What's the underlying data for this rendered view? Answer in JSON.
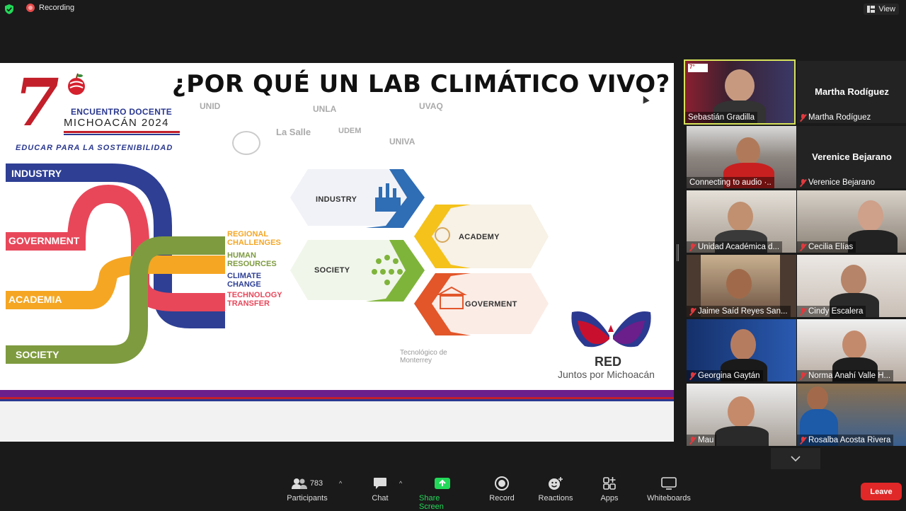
{
  "topbar": {
    "recording_label": "Recording",
    "view_label": "View"
  },
  "slide": {
    "title": "¿POR QUÉ UN LAB CLIMÁTICO VIVO?",
    "event_logo": {
      "number": "7",
      "line1": "ENCUENTRO DOCENTE",
      "line2": "MICHOACÁN 2024",
      "line3": "EDUCAR PARA LA SOSTENIBILIDAD"
    },
    "institutions": [
      "UNID",
      "UNLA",
      "UVAQ",
      "La Salle",
      "UDEM",
      "UNIVA",
      "Tecnológico de Monterrey"
    ],
    "stream_labels": [
      "INDUSTRY",
      "GOVERNMENT",
      "ACADEMIA",
      "SOCIETY"
    ],
    "stream_colors": {
      "industry": "#2e3f94",
      "government": "#e8475a",
      "academia": "#f5a623",
      "society": "#7e9b3f"
    },
    "outcomes": [
      {
        "label": "REGIONAL CHALLENGES",
        "line1": "REGIONAL",
        "line2": "CHALLENGES",
        "color": "#f5a623"
      },
      {
        "label": "HUMAN RESOURCES",
        "line1": "HUMAN",
        "line2": "RESOURCES",
        "color": "#7e9b3f"
      },
      {
        "label": "CLIMATE CHANGE",
        "line1": "CLIMATE",
        "line2": "CHANGE",
        "color": "#2e3f94"
      },
      {
        "label": "TECHNOLOGY TRANSFER",
        "line1": "TECHNOLOGY",
        "line2": "TRANSFER",
        "color": "#e8475a"
      }
    ],
    "hexagons": [
      {
        "label": "INDUSTRY",
        "color": "#2f6db4"
      },
      {
        "label": "ACADEMY",
        "color": "#f4c21b"
      },
      {
        "label": "SOCIETY",
        "color": "#7fb43b"
      },
      {
        "label": "GOVERMENT",
        "color": "#e2562a"
      }
    ],
    "red_logo": {
      "title": "RED",
      "subtitle": "Juntos por Michoacán"
    }
  },
  "participants": [
    {
      "name": "Sebastián Gradilla",
      "muted": false,
      "active": true
    },
    {
      "name": "Martha Rodíguez",
      "muted": true,
      "video": false
    },
    {
      "name": "Connecting to audio ·..",
      "muted": false
    },
    {
      "name": "Verenice Bejarano",
      "muted": true,
      "video": false
    },
    {
      "name": "Unidad Académica d...",
      "muted": true
    },
    {
      "name": "Cecilia Elías",
      "muted": true
    },
    {
      "name": "Jaime Saíd Reyes San...",
      "muted": true
    },
    {
      "name": "Cindy Escalera",
      "muted": true
    },
    {
      "name": "Georgina Gaytán",
      "muted": true
    },
    {
      "name": "Norma Anahí Valle H...",
      "muted": true
    },
    {
      "name": "Mau",
      "muted": true
    },
    {
      "name": "Rosalba Acosta Rivera",
      "muted": true
    }
  ],
  "toolbar": {
    "participants_label": "Participants",
    "participants_count": "783",
    "chat_label": "Chat",
    "share_label": "Share Screen",
    "record_label": "Record",
    "reactions_label": "Reactions",
    "apps_label": "Apps",
    "whiteboards_label": "Whiteboards",
    "leave_label": "Leave",
    "share_color": "#23d959",
    "leave_color": "#e02828"
  }
}
